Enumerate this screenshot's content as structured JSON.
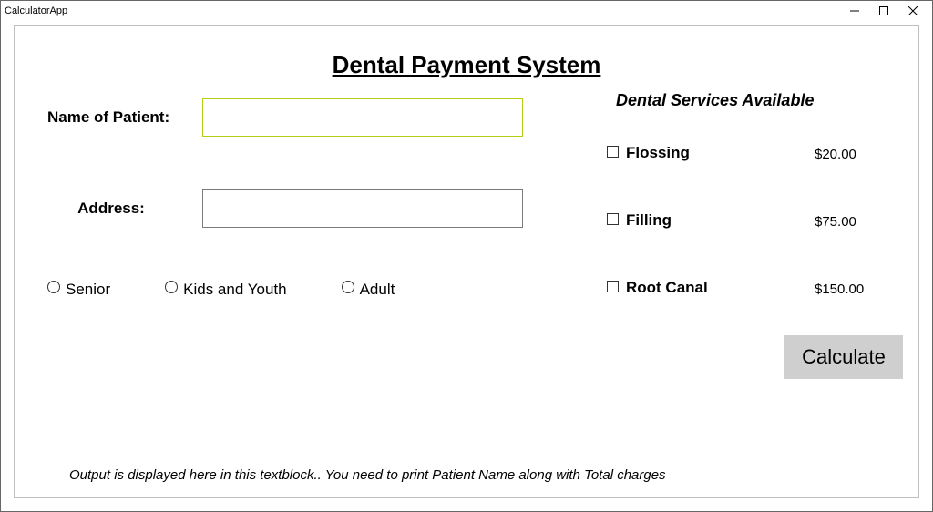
{
  "window": {
    "title": "CalculatorApp"
  },
  "header": {
    "title": "Dental Payment System"
  },
  "form": {
    "name_label": "Name of Patient:",
    "name_value": "",
    "address_label": "Address:",
    "address_value": ""
  },
  "radios": {
    "senior": "Senior",
    "kids": "Kids and Youth",
    "adult": "Adult"
  },
  "services": {
    "header": "Dental Services Available",
    "items": [
      {
        "label": "Flossing",
        "price": "$20.00"
      },
      {
        "label": "Filling",
        "price": "$75.00"
      },
      {
        "label": "Root Canal",
        "price": "$150.00"
      }
    ]
  },
  "buttons": {
    "calculate": "Calculate"
  },
  "output": {
    "placeholder": "Output is displayed here in this textblock.. You need to print Patient Name along with Total charges"
  }
}
